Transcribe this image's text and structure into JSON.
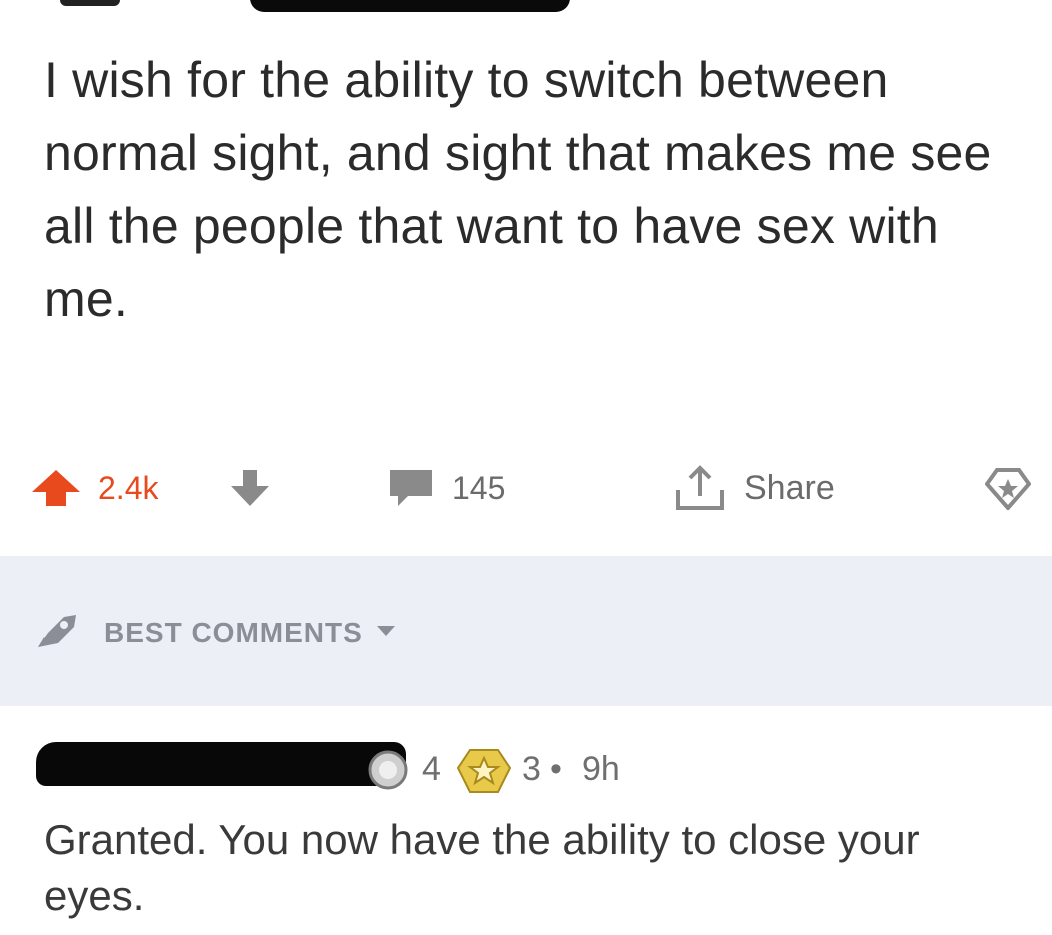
{
  "post": {
    "body": "I wish for the ability to switch between normal sight, and sight that makes me see all the people that want to have sex with me."
  },
  "actions": {
    "score": "2.4k",
    "comments_count": "145",
    "share_label": "Share"
  },
  "icons": {
    "upvote": "upvote-arrow-icon",
    "downvote": "downvote-arrow-icon",
    "comment": "comment-bubble-icon",
    "share": "share-icon",
    "save": "save-bookmark-icon",
    "sort": "rocket-icon",
    "karma": "karma-badge-icon",
    "award": "award-badge-icon"
  },
  "colors": {
    "upvote_active": "#e8491d",
    "muted": "#6b6b6b",
    "sort_bar_bg": "#eceff6"
  },
  "comments_sort": {
    "label": "BEST COMMENTS"
  },
  "comment": {
    "karma_badge_count": "4",
    "award_count": "3",
    "separator": "•",
    "age": "9h",
    "body": "Granted. You now have the ability to close your eyes."
  }
}
